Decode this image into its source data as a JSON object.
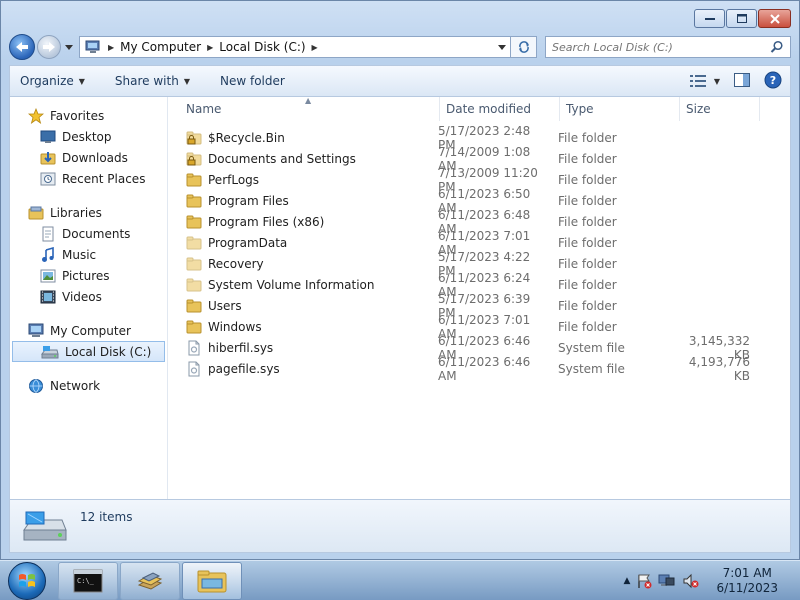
{
  "address": {
    "crumbs": [
      "My Computer",
      "Local Disk (C:)"
    ],
    "search_placeholder": "Search Local Disk (C:)"
  },
  "toolbar": {
    "organize_label": "Organize",
    "share_label": "Share with",
    "new_folder_label": "New folder"
  },
  "nav_pane": {
    "favorites": "Favorites",
    "desktop": "Desktop",
    "downloads": "Downloads",
    "recent_places": "Recent Places",
    "libraries": "Libraries",
    "documents": "Documents",
    "music": "Music",
    "pictures": "Pictures",
    "videos": "Videos",
    "my_computer": "My Computer",
    "local_disk": "Local Disk (C:)",
    "network": "Network"
  },
  "columns": {
    "name": "Name",
    "date_modified": "Date modified",
    "type": "Type",
    "size": "Size"
  },
  "files": [
    {
      "name": "$Recycle.Bin",
      "date": "5/17/2023 2:48 PM",
      "type": "File folder",
      "size": "",
      "icon": "locked-folder-icon"
    },
    {
      "name": "Documents and Settings",
      "date": "7/14/2009 1:08 AM",
      "type": "File folder",
      "size": "",
      "icon": "locked-folder-icon"
    },
    {
      "name": "PerfLogs",
      "date": "7/13/2009 11:20 PM",
      "type": "File folder",
      "size": "",
      "icon": "folder-icon"
    },
    {
      "name": "Program Files",
      "date": "6/11/2023 6:50 AM",
      "type": "File folder",
      "size": "",
      "icon": "folder-icon"
    },
    {
      "name": "Program Files (x86)",
      "date": "6/11/2023 6:48 AM",
      "type": "File folder",
      "size": "",
      "icon": "folder-icon"
    },
    {
      "name": "ProgramData",
      "date": "6/11/2023 7:01 AM",
      "type": "File folder",
      "size": "",
      "icon": "hidden-folder-icon"
    },
    {
      "name": "Recovery",
      "date": "5/17/2023 4:22 PM",
      "type": "File folder",
      "size": "",
      "icon": "hidden-folder-icon"
    },
    {
      "name": "System Volume Information",
      "date": "6/11/2023 6:24 AM",
      "type": "File folder",
      "size": "",
      "icon": "hidden-folder-icon"
    },
    {
      "name": "Users",
      "date": "5/17/2023 6:39 PM",
      "type": "File folder",
      "size": "",
      "icon": "folder-icon"
    },
    {
      "name": "Windows",
      "date": "6/11/2023 7:01 AM",
      "type": "File folder",
      "size": "",
      "icon": "folder-icon"
    },
    {
      "name": "hiberfil.sys",
      "date": "6/11/2023 6:46 AM",
      "type": "System file",
      "size": "3,145,332 KB",
      "icon": "system-file-icon"
    },
    {
      "name": "pagefile.sys",
      "date": "6/11/2023 6:46 AM",
      "type": "System file",
      "size": "4,193,776 KB",
      "icon": "system-file-icon"
    }
  ],
  "details": {
    "item_count": "12 items"
  },
  "taskbar": {
    "time": "7:01 AM",
    "date": "6/11/2023"
  },
  "colors": {
    "folder": "#e8c35a",
    "accent": "#2a64b8"
  }
}
